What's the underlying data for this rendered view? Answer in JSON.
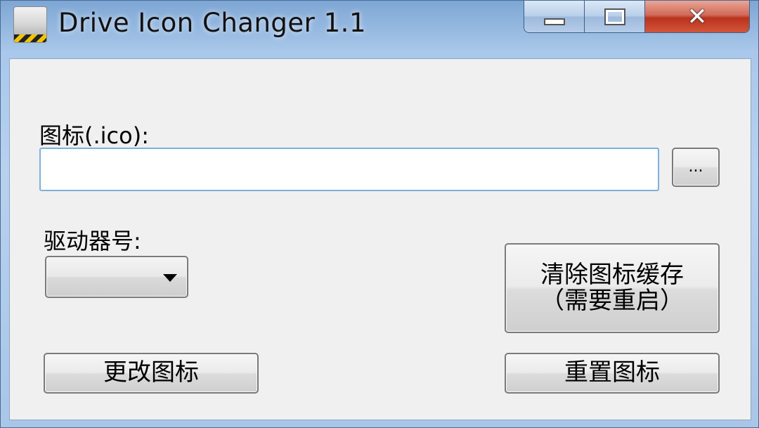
{
  "window": {
    "title": "Drive Icon Changer 1.1",
    "icon": "drive-icon",
    "controls": {
      "minimize_icon": "minimize-icon",
      "maximize_icon": "maximize-icon",
      "close_icon": "close-icon",
      "close_glyph": "✕"
    }
  },
  "form": {
    "icon_label": "图标(.ico):",
    "icon_path_value": "",
    "browse_label": "...",
    "drive_label": "驱动器号:",
    "drive_selected": "",
    "clear_cache_line1": "清除图标缓存",
    "clear_cache_line2": "（需要重启）",
    "change_label": "更改图标",
    "reset_label": "重置图标"
  },
  "colors": {
    "titlebar": "#a9c8ea",
    "client_bg": "#f0f0f0",
    "close_red": "#c9452f",
    "input_border": "#7fb0da"
  }
}
